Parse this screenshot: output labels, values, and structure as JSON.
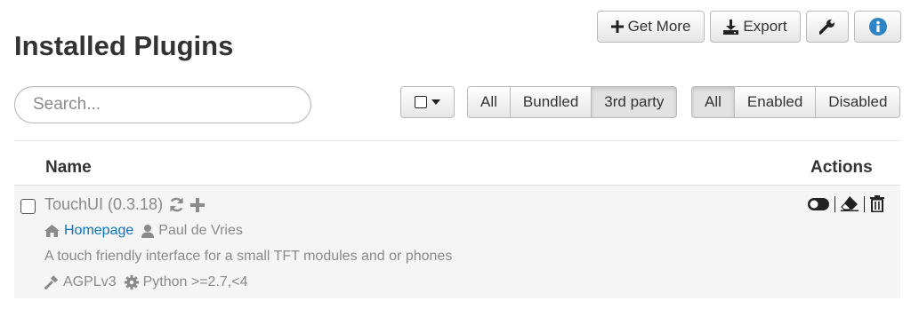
{
  "page_title": "Installed Plugins",
  "toolbar": {
    "get_more_label": "Get More",
    "export_label": "Export",
    "settings_icon": "wrench-icon",
    "info_icon": "info-icon"
  },
  "search": {
    "placeholder": "Search..."
  },
  "filters": {
    "source": [
      {
        "label": "All",
        "active": false
      },
      {
        "label": "Bundled",
        "active": false
      },
      {
        "label": "3rd party",
        "active": true
      }
    ],
    "state": [
      {
        "label": "All",
        "active": true
      },
      {
        "label": "Enabled",
        "active": false
      },
      {
        "label": "Disabled",
        "active": false
      }
    ]
  },
  "table": {
    "columns": {
      "name": "Name",
      "actions": "Actions"
    },
    "rows": [
      {
        "title": "TouchUI (0.3.18)",
        "homepage_label": "Homepage",
        "author": "Paul de Vries",
        "description": "A touch friendly interface for a small TFT modules and or phones",
        "license": "AGPLv3",
        "python": "Python >=2.7,<4"
      }
    ]
  },
  "colors": {
    "link": "#0f74b8",
    "info_blue": "#2f85c4",
    "muted_text": "#8a8a8a"
  }
}
